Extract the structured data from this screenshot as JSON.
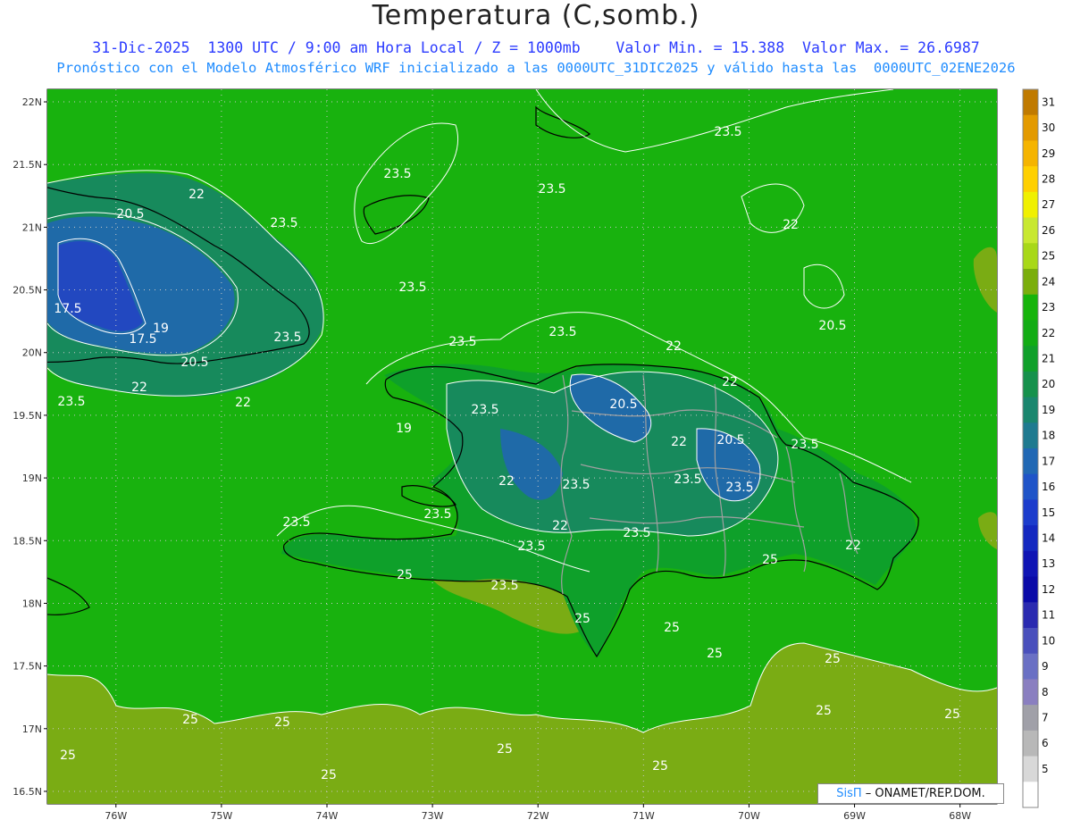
{
  "header": {
    "title": "Temperatura (C,somb.)",
    "subtitle_line1": "31-Dic-2025  1300 UTC / 9:00 am Hora Local / Z = 1000mb    Valor Min. = 15.388  Valor Max. = 26.6987",
    "subtitle_line2": "Pronóstico con el Modelo Atmosférico WRF inicializado a las 0000UTC_31DIC2025 y válido hasta las  0000UTC_02ENE2026"
  },
  "axes": {
    "lat_ticks": [
      "22N",
      "21.5N",
      "21N",
      "20.5N",
      "20N",
      "19.5N",
      "19N",
      "18.5N",
      "18N",
      "17.5N",
      "17N",
      "16.5N"
    ],
    "lon_ticks": [
      "76W",
      "75W",
      "74W",
      "73W",
      "72W",
      "71W",
      "70W",
      "69W",
      "68W"
    ],
    "lat_range": [
      16.4,
      22.1
    ],
    "lon_range": [
      -76.65,
      -67.65
    ],
    "grid": true
  },
  "contour_labels": [
    "22",
    "20.5",
    "23.5",
    "23.5",
    "23.5",
    "23.5",
    "17.5",
    "19",
    "17.5",
    "20.5",
    "22",
    "23.5",
    "23.5",
    "22",
    "23.5",
    "23.5",
    "22",
    "23.5",
    "22",
    "20.5",
    "22",
    "20.5",
    "23.5",
    "19",
    "22",
    "20.5",
    "23.5",
    "22",
    "23.5",
    "23.5",
    "23.5",
    "23.5",
    "23.5",
    "22",
    "23.5",
    "23.5",
    "22",
    "25",
    "25",
    "23.5",
    "25",
    "25",
    "25",
    "25",
    "25",
    "25",
    "25",
    "25",
    "25",
    "25",
    "25",
    "25"
  ],
  "colorbar": {
    "levels": [
      "31",
      "30",
      "29",
      "28",
      "27",
      "26",
      "25",
      "24",
      "23",
      "22",
      "21",
      "20",
      "19",
      "18",
      "17",
      "16",
      "15",
      "14",
      "13",
      "12",
      "11",
      "10",
      "9",
      "8",
      "7",
      "6",
      "5"
    ],
    "colors": [
      "#c07a00",
      "#e39a00",
      "#f5b400",
      "#ffd000",
      "#f0f000",
      "#c8e830",
      "#a8d818",
      "#7aae0c",
      "#16b40a",
      "#12ac14",
      "#10a02a",
      "#16914c",
      "#1a866e",
      "#1f7a90",
      "#2168b4",
      "#1f54c8",
      "#1c3ccc",
      "#1428c0",
      "#0f14b4",
      "#0a0aa8",
      "#2a2ab0",
      "#4a50bc",
      "#6a70c4",
      "#8a7fc0",
      "#a0a0a8",
      "#b8b8b8",
      "#d8d8d8",
      "#ffffff"
    ]
  },
  "credit": {
    "sis": "SisΠ",
    "org": " – ONAMET/REP.DOM."
  },
  "field": {
    "sea_color": "#18b20e",
    "warm_sea_color": "#7aac14",
    "land_color": "#0ea02a",
    "cool_color": "#178a5c",
    "cold_color": "#1f6aa8",
    "coldest_color": "#2248c0",
    "coast_color": "#000000",
    "border_color": "#a0a0a0",
    "contour_color": "#ffffff"
  }
}
